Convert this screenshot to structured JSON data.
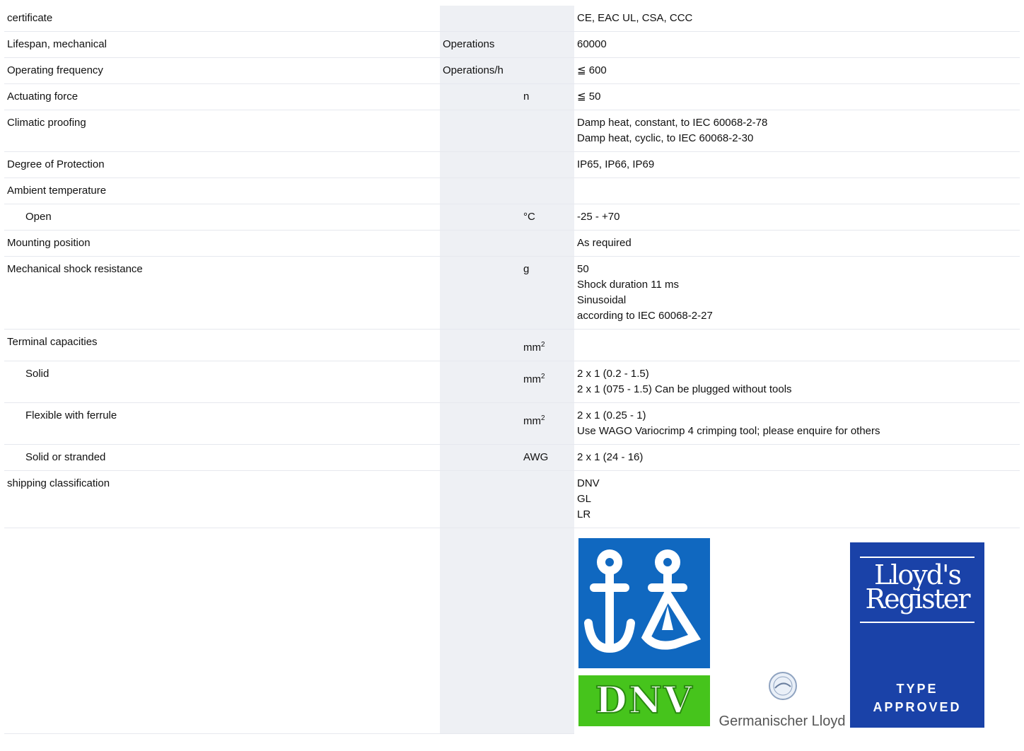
{
  "rows": [
    {
      "label": "certificate",
      "unit1": "",
      "unit2": "",
      "values": [
        "CE, EAC UL, CSA, CCC"
      ]
    },
    {
      "label": "Lifespan, mechanical",
      "unit1": "Operations",
      "unit2": "",
      "values": [
        "60000"
      ]
    },
    {
      "label": "Operating frequency",
      "unit1": "Operations/h",
      "unit2": "",
      "values": [
        "≦ 600"
      ]
    },
    {
      "label": "Actuating force",
      "unit1": "",
      "unit2": "n",
      "values": [
        "≦ 50"
      ]
    },
    {
      "label": "Climatic proofing",
      "unit1": "",
      "unit2": "",
      "values": [
        "Damp heat, constant, to IEC 60068-2-78",
        "Damp heat, cyclic, to IEC 60068-2-30"
      ]
    },
    {
      "label": "Degree of Protection",
      "unit1": "",
      "unit2": "",
      "values": [
        "IP65, IP66, IP69"
      ]
    },
    {
      "label": "Ambient temperature",
      "unit1": "",
      "unit2": "",
      "values": [
        ""
      ]
    },
    {
      "label": "Open",
      "unit1": "",
      "unit2": "°C",
      "values": [
        "-25 - +70"
      ]
    },
    {
      "label": "Mounting position",
      "unit1": "",
      "unit2": "",
      "values": [
        "As required"
      ]
    },
    {
      "label": "Mechanical shock resistance",
      "unit1": "",
      "unit2": "g",
      "values": [
        "50",
        "Shock duration 11 ms",
        "Sinusoidal",
        "according to IEC 60068-2-27"
      ]
    },
    {
      "label": "Terminal capacities",
      "unit1": "",
      "unit2": "mm",
      "values": [
        ""
      ]
    },
    {
      "label": "Solid",
      "unit1": "",
      "unit2": "mm",
      "values": [
        "2 x 1 (0.2 - 1.5)",
        "2 x 1 (075 - 1.5) Can be plugged without tools"
      ]
    },
    {
      "label": "Flexible with ferrule",
      "unit1": "",
      "unit2": "mm",
      "values": [
        "2 x 1 (0.25 - 1)",
        "Use WAGO Variocrimp 4 crimping tool; please enquire for others"
      ]
    },
    {
      "label": "Solid or stranded",
      "unit1": "",
      "unit2": "AWG",
      "values": [
        "2 x 1 (24 - 16)"
      ]
    },
    {
      "label": "shipping classification",
      "unit1": "",
      "unit2": "",
      "values": [
        "DNV",
        "GL",
        "LR"
      ]
    }
  ],
  "unit_superscript": "2",
  "logos": {
    "dnv_text": "DNV",
    "gl_text": "Germanischer Lloyd",
    "lr_line1": "Lloyd's",
    "lr_line2": "Register",
    "lr_type": "TYPE",
    "lr_approved": "APPROVED",
    "dnv_blue": "#1068c0",
    "dnv_green": "#46c41c",
    "lr_blue": "#1a42a8"
  }
}
